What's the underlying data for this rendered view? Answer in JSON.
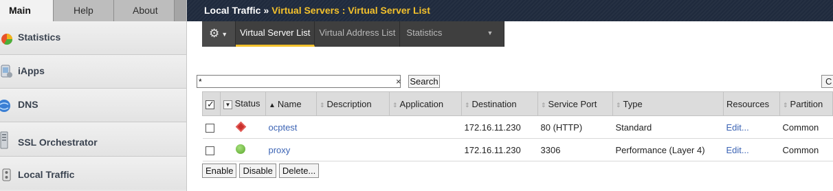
{
  "top_tabs": [
    {
      "label": "Main"
    },
    {
      "label": "Help"
    },
    {
      "label": "About"
    }
  ],
  "nav": [
    {
      "label": "Statistics",
      "icon": "statistics-pie-icon"
    },
    {
      "label": "iApps",
      "icon": "iapps-icon"
    },
    {
      "label": "DNS",
      "icon": "dns-globe-icon"
    },
    {
      "label": "SSL Orchestrator",
      "icon": "ssl-orchestrator-icon"
    },
    {
      "label": "Local Traffic",
      "icon": "local-traffic-icon"
    }
  ],
  "breadcrumb": {
    "section": "Local Traffic",
    "separator": "»",
    "page": "Virtual Servers : Virtual Server List"
  },
  "subtabs": {
    "gear": "gear-icon",
    "items": [
      {
        "label": "Virtual Server List",
        "active": true
      },
      {
        "label": "Virtual Address List"
      },
      {
        "label": "Statistics"
      }
    ]
  },
  "search": {
    "value": "*",
    "button": "Search",
    "create_button": "C"
  },
  "table": {
    "headers": {
      "status": "Status",
      "name": "Name",
      "description": "Description",
      "application": "Application",
      "destination": "Destination",
      "service_port": "Service Port",
      "type": "Type",
      "resources": "Resources",
      "partition": "Partition"
    },
    "rows": [
      {
        "status": "offline",
        "name": "ocptest",
        "description": "",
        "application": "",
        "destination": "172.16.11.230",
        "service_port": "80 (HTTP)",
        "type": "Standard",
        "resources": "Edit...",
        "partition": "Common"
      },
      {
        "status": "available",
        "name": "proxy",
        "description": "",
        "application": "",
        "destination": "172.16.11.230",
        "service_port": "3306",
        "type": "Performance (Layer 4)",
        "resources": "Edit...",
        "partition": "Common"
      }
    ]
  },
  "actions": {
    "enable": "Enable",
    "disable": "Disable",
    "delete": "Delete..."
  },
  "colors": {
    "accent": "#f3c12c",
    "titlebar": "#1f2a3d",
    "link": "#3b63b4",
    "status_offline": "#c9302c",
    "status_available": "#5aa62c"
  }
}
